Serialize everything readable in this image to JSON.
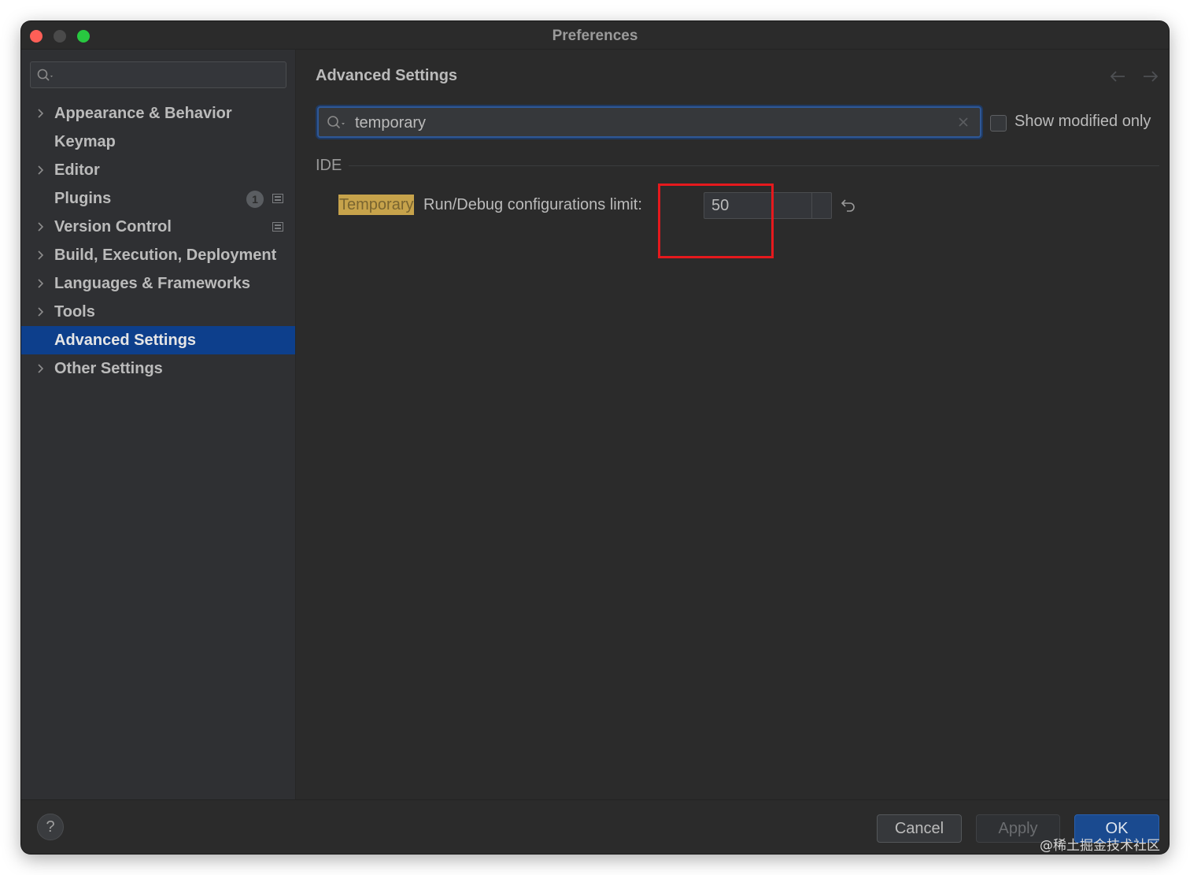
{
  "window": {
    "title": "Preferences",
    "colors": {
      "close": "#fe5f57",
      "minimize": "#4a4a4a",
      "zoom": "#28c840",
      "selection": "#0d3f8c",
      "highlight": "#c7a34b",
      "annotation": "#e5191d"
    }
  },
  "sidebar": {
    "search_value": "",
    "items": [
      {
        "label": "Appearance & Behavior",
        "expandable": true
      },
      {
        "label": "Keymap",
        "expandable": false
      },
      {
        "label": "Editor",
        "expandable": true
      },
      {
        "label": "Plugins",
        "expandable": false,
        "badge": "1"
      },
      {
        "label": "Version Control",
        "expandable": true
      },
      {
        "label": "Build, Execution, Deployment",
        "expandable": true
      },
      {
        "label": "Languages & Frameworks",
        "expandable": true
      },
      {
        "label": "Tools",
        "expandable": true
      },
      {
        "label": "Advanced Settings",
        "expandable": false,
        "selected": true
      },
      {
        "label": "Other Settings",
        "expandable": true
      }
    ]
  },
  "main": {
    "title": "Advanced Settings",
    "filter": {
      "value": "temporary"
    },
    "show_modified_only": {
      "label": "Show modified only",
      "checked": false
    },
    "group": "IDE",
    "setting": {
      "highlight": "Temporary",
      "label": "Run/Debug configurations limit:",
      "value": "50"
    }
  },
  "footer": {
    "help": "?",
    "cancel": "Cancel",
    "apply": "Apply",
    "ok": "OK"
  },
  "watermark": "@稀土掘金技术社区"
}
